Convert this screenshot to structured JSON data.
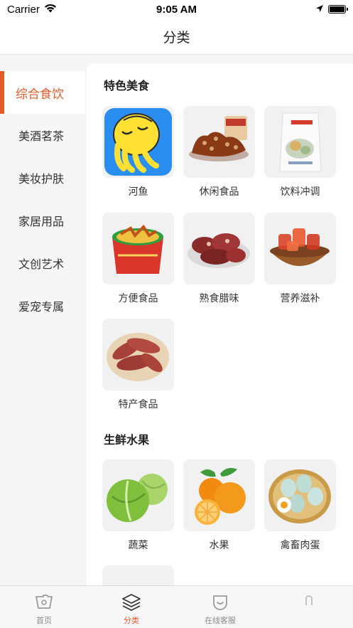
{
  "status_bar": {
    "carrier": "Carrier",
    "time": "9:05 AM"
  },
  "nav": {
    "title": "分类"
  },
  "sidebar": {
    "items": [
      {
        "label": "综合食饮",
        "active": true
      },
      {
        "label": "美酒茗茶",
        "active": false
      },
      {
        "label": "美妆护肤",
        "active": false
      },
      {
        "label": "家居用品",
        "active": false
      },
      {
        "label": "文创艺术",
        "active": false
      },
      {
        "label": "爱宠专属",
        "active": false
      }
    ]
  },
  "sections": [
    {
      "title": "特色美食",
      "items": [
        {
          "label": "河鱼",
          "icon": "hey-fish-logo-icon"
        },
        {
          "label": "休闲食品",
          "icon": "snack-food-icon"
        },
        {
          "label": "饮料冲调",
          "icon": "drink-bag-icon"
        },
        {
          "label": "方便食品",
          "icon": "instant-food-icon"
        },
        {
          "label": "熟食腊味",
          "icon": "cured-meat-icon"
        },
        {
          "label": "营养滋补",
          "icon": "jelly-bowl-icon"
        },
        {
          "label": "特产食品",
          "icon": "sweet-potato-icon"
        }
      ]
    },
    {
      "title": "生鲜水果",
      "items": [
        {
          "label": "蔬菜",
          "icon": "cabbage-icon"
        },
        {
          "label": "水果",
          "icon": "orange-icon"
        },
        {
          "label": "禽畜肉蛋",
          "icon": "eggs-basket-icon"
        },
        {
          "label": "",
          "icon": "partial-item-icon"
        }
      ]
    }
  ],
  "tab_bar": {
    "items": [
      {
        "label": "首页",
        "icon": "home-icon",
        "active": false
      },
      {
        "label": "分类",
        "icon": "category-icon",
        "active": true
      },
      {
        "label": "在线客服",
        "icon": "service-icon",
        "active": false
      },
      {
        "label": "",
        "icon": "profile-icon",
        "active": false
      }
    ]
  },
  "colors": {
    "accent": "#e4592a",
    "background": "#f5f5f5",
    "card": "#f1f1f1"
  }
}
